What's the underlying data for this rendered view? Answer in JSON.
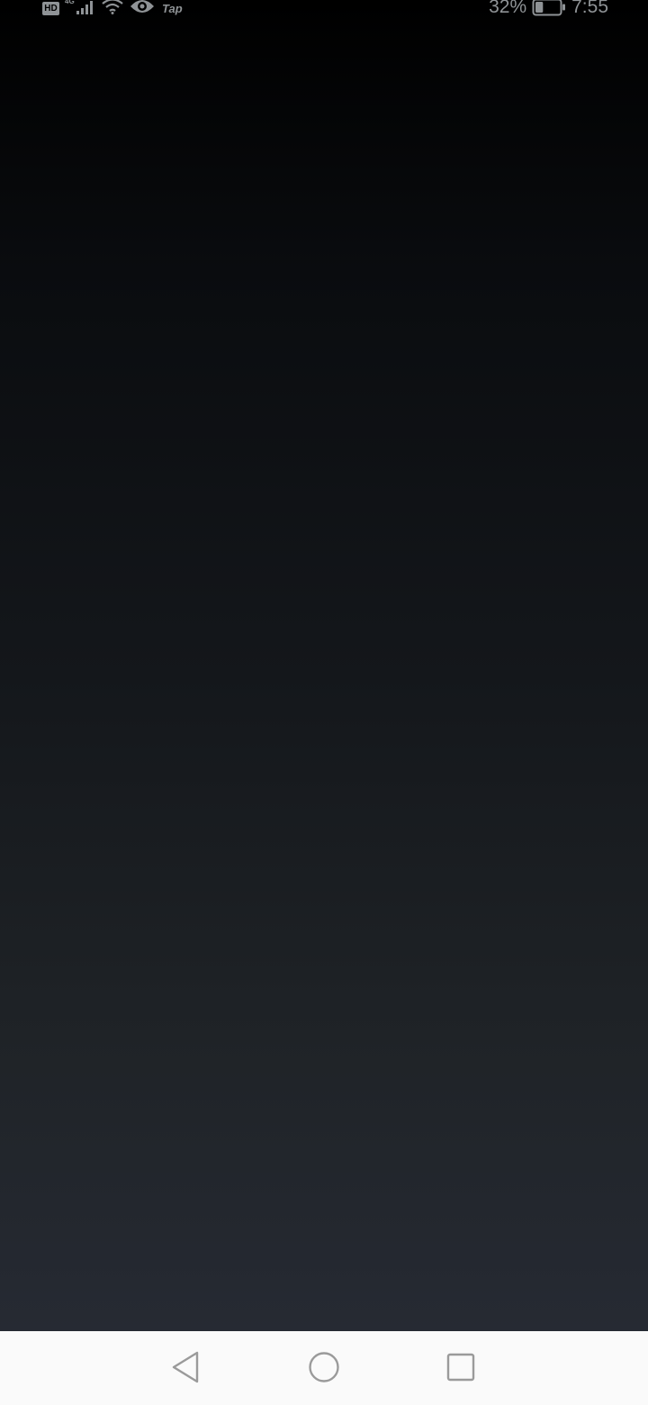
{
  "status_bar": {
    "hd_badge": "HD",
    "network_type": "4G",
    "app_label": "Tap",
    "battery_percent": "32%",
    "time": "7:55",
    "battery_level": 0.32,
    "icons": [
      "hd-icon",
      "signal-icon",
      "wifi-icon",
      "eye-icon",
      "battery-icon"
    ]
  },
  "nav_bar": {
    "buttons": [
      "back-triangle-icon",
      "home-circle-icon",
      "recents-square-icon"
    ]
  },
  "colors": {
    "status_text": "#8f9396",
    "nav_background": "#fafafa",
    "nav_icon": "#9a9a9a",
    "content_top": "#000000",
    "content_bottom": "#262a33"
  }
}
